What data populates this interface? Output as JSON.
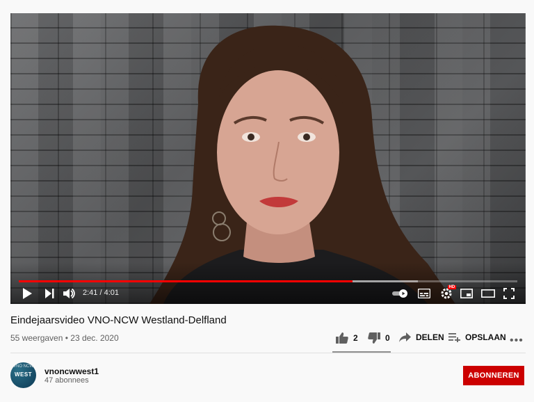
{
  "player": {
    "time_current": "2:41",
    "time_separator": " / ",
    "time_total": "4:01",
    "progress_fraction": 0.67,
    "accent_color": "#ff0000",
    "hd_badge": "HD"
  },
  "video": {
    "title": "Eindejaarsvideo VNO-NCW Westland-Delfland",
    "views": "55 weergaven",
    "separator": " • ",
    "date": "23 dec. 2020"
  },
  "actions": {
    "like_count": "2",
    "dislike_count": "0",
    "share_label": "DELEN",
    "save_label": "OPSLAAN",
    "more_label": "•••"
  },
  "channel": {
    "name": "vnoncwwest1",
    "subscribers": "47 abonnees",
    "avatar_text": "WEST",
    "avatar_top_text": "VNO NCW"
  },
  "subscribe": {
    "label": "ABONNEREN",
    "color": "#cc0000"
  },
  "icons": [
    "play-icon",
    "next-icon",
    "volume-icon",
    "autoplay-toggle-icon",
    "subtitles-icon",
    "settings-icon",
    "miniplayer-icon",
    "theater-icon",
    "fullscreen-icon",
    "thumbs-up-icon",
    "thumbs-down-icon",
    "share-icon",
    "save-playlist-icon",
    "more-icon"
  ]
}
